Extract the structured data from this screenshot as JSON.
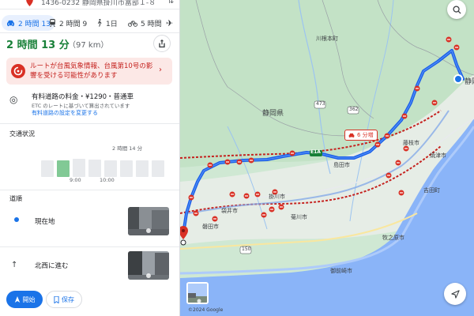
{
  "top": {
    "address_partial": "1436-0232 静岡県掛川市富部１-８"
  },
  "modes": [
    {
      "name": "car",
      "label": "2 時間 13"
    },
    {
      "name": "transit",
      "label": "2 時間 9"
    },
    {
      "name": "walk",
      "label": "1日"
    },
    {
      "name": "bike",
      "label": "5 時間"
    }
  ],
  "summary": {
    "duration": "2 時間 13 分",
    "distance": "（97 km）"
  },
  "alert": {
    "text": "ルートが台風気象情報、台風第10号の影響を受ける可能性があります"
  },
  "toll": {
    "line1": "有料道路の料金・¥1290・普通車",
    "line2": "ETC のレートに基づいて算出されています",
    "link": "有料道路の設定を変更する"
  },
  "traffic": {
    "heading": "交通状況",
    "caption": "2 時間 14 分",
    "tick1": "9:00",
    "tick2": "10:00",
    "bars": [
      0.62,
      0.62,
      0.68,
      0.66,
      0.62,
      0.62,
      0.62,
      0.62
    ]
  },
  "steps": {
    "heading": "道順",
    "items": [
      {
        "label": "現在地"
      },
      {
        "label": "北西に進む"
      }
    ]
  },
  "footer": {
    "start": "開始",
    "save": "保存"
  },
  "map": {
    "labels": {
      "kawanehoncho": "川根本町",
      "shizuoka_pref": "静岡県",
      "shizuoka_city": "静岡",
      "fujieda": "藤枝市",
      "yaizu": "焼津市",
      "yoshida": "吉田町",
      "shimada": "島田市",
      "makinohara": "牧之原市",
      "kikugawa": "菊川市",
      "kakegawa": "掛川市",
      "iwata": "磐田市",
      "omaezaki": "御前崎市",
      "fukuroi": "袋井市",
      "route_e1a": "E1A",
      "route_473": "473",
      "route_362": "362",
      "route_150": "150"
    },
    "delay": "6 分増",
    "copyright": "©2024 Google"
  },
  "colors": {
    "route": "#1a5ee8",
    "alert_red": "#d93025",
    "green_time": "#188038",
    "accent": "#1a73e8"
  }
}
